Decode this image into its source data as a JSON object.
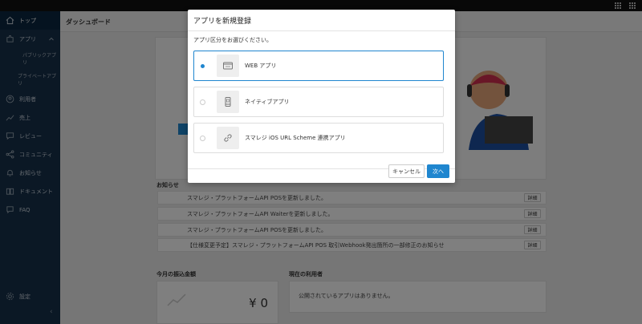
{
  "header": {
    "title": "ダッシュボード"
  },
  "sidebar": {
    "items": [
      {
        "label": "トップ",
        "icon": "home-icon"
      },
      {
        "label": "アプリ",
        "icon": "puzzle-icon"
      },
      {
        "label": "利用者",
        "icon": "user-icon"
      },
      {
        "label": "売上",
        "icon": "trend-icon"
      },
      {
        "label": "レビュー",
        "icon": "chat-icon"
      },
      {
        "label": "コミュニティ",
        "icon": "share-icon"
      },
      {
        "label": "お知らせ",
        "icon": "bell-icon"
      },
      {
        "label": "ドキュメント",
        "icon": "book-icon"
      },
      {
        "label": "FAQ",
        "icon": "question-icon"
      }
    ],
    "sub_items": [
      "パブリックアプリ",
      "プライベートアプリ"
    ],
    "settings_label": "設定"
  },
  "news": {
    "title": "お知らせ",
    "detail_label": "詳細",
    "rows": [
      "スマレジ・プラットフォームAPI POSを更新しました。",
      "スマレジ・プラットフォームAPI Waiterを更新しました。",
      "スマレジ・プラットフォームAPI POSを更新しました。",
      "【仕様変更予定】スマレジ・プラットフォームAPI POS 取引Webhook発出箇所の一部修正のお知らせ"
    ]
  },
  "payout": {
    "title": "今月の振込金額",
    "amount": "¥ 0"
  },
  "current_users": {
    "title": "現在の利用者",
    "empty_text": "公開されているアプリはありません。"
  },
  "modal": {
    "title": "アプリを新規登録",
    "subtitle": "アプリ区分をお選びください。",
    "options": [
      {
        "label": "WEB アプリ",
        "icon": "browser-window-icon",
        "selected": true
      },
      {
        "label": "ネイティブアプリ",
        "icon": "smartphone-icon",
        "selected": false
      },
      {
        "label": "スマレジ iOS URL Scheme 連携アプリ",
        "icon": "link-icon",
        "selected": false
      }
    ],
    "cancel_label": "キャンセル",
    "next_label": "次へ"
  },
  "colors": {
    "sidebar": "#17314a",
    "accent": "#1f86cf"
  }
}
